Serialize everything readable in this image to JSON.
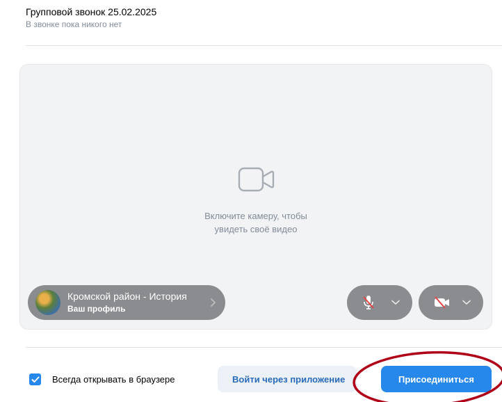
{
  "header": {
    "title": "Групповой звонок 25.02.2025",
    "subtitle": "В звонке пока никого нет"
  },
  "preview": {
    "hint_line1": "Включите камеру, чтобы",
    "hint_line2": "увидеть своё видео",
    "camera_icon": "video-camera-icon"
  },
  "profile": {
    "name": "Кромской район - История",
    "subtitle": "Ваш профиль",
    "avatar": "avatar-image"
  },
  "controls": {
    "mic_icon": "microphone-off-icon",
    "cam_icon": "camera-off-icon",
    "chevron_icon": "chevron-down-icon"
  },
  "footer": {
    "always_browser_label": "Всегда открывать в браузере",
    "always_browser_checked": true,
    "open_app_label": "Войти через приложение",
    "join_label": "Присоединиться"
  },
  "colors": {
    "accent": "#2688eb",
    "pill_bg": "#8b8c8f",
    "preview_bg": "#f2f3f5",
    "annotation": "#b00018"
  }
}
